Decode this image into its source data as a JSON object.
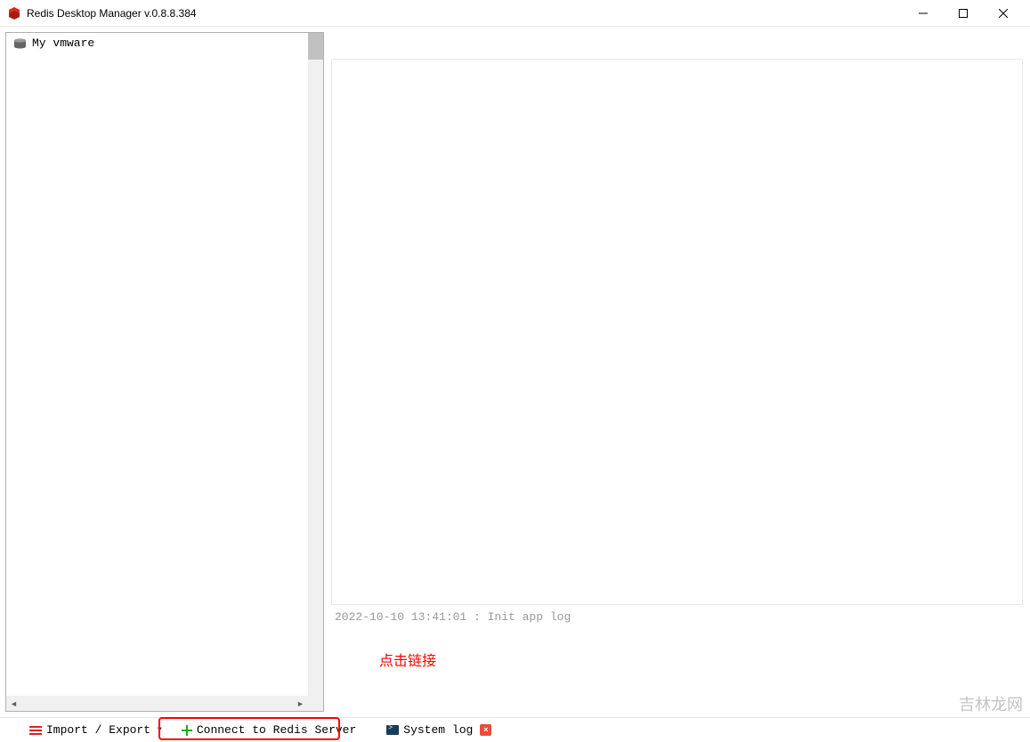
{
  "titlebar": {
    "title": "Redis Desktop Manager v.0.8.8.384"
  },
  "sidebar": {
    "connections": [
      {
        "name": "My vmware"
      }
    ]
  },
  "log": {
    "entry": "2022-10-10 13:41:01 : Init app log"
  },
  "annotation": {
    "text": "点击链接"
  },
  "toolbar": {
    "import_export_label": "Import / Export",
    "connect_label": "Connect to Redis Server",
    "system_log_label": "System log"
  },
  "watermark": "吉林龙网"
}
